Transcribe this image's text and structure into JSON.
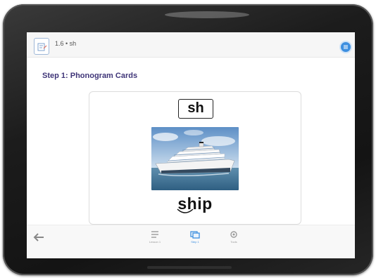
{
  "header": {
    "lesson_label": "1.6 • sh",
    "lesson_icon": "lesson-document-icon",
    "menu_icon": "blue-menu-icon"
  },
  "step": {
    "title": "Step 1: Phonogram Cards"
  },
  "card": {
    "phonogram": "sh",
    "word": "ship",
    "image": "cruise-ship-photo"
  },
  "bottom_nav": {
    "back_icon": "back-arrow-icon",
    "items": [
      {
        "icon": "list-icon",
        "label": "Lesson 1"
      },
      {
        "icon": "flashcard-icon",
        "label": "Step 1"
      },
      {
        "icon": "gear-icon",
        "label": "Tools"
      }
    ],
    "active_index": 1
  },
  "colors": {
    "title": "#3f3578",
    "accent": "#3d8fe0"
  }
}
